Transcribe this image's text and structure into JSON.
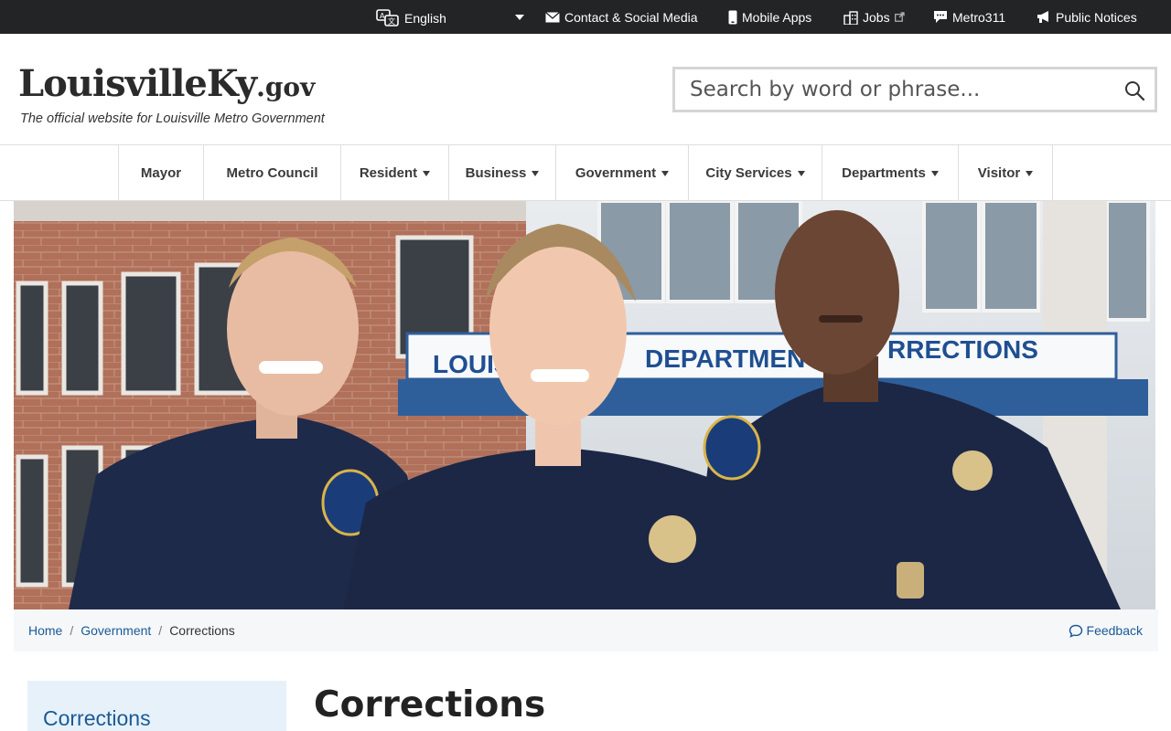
{
  "topbar": {
    "language": "English",
    "links": [
      {
        "label": "Contact & Social Media",
        "icon": "envelope-icon"
      },
      {
        "label": "Mobile Apps",
        "icon": "phone-icon"
      },
      {
        "label": "Jobs",
        "icon": "buildings-icon",
        "external_icon": "external-link-icon"
      },
      {
        "label": "Metro311",
        "icon": "chat-icon"
      },
      {
        "label": "Public Notices",
        "icon": "megaphone-icon"
      }
    ]
  },
  "header": {
    "logo_main": "LouisvilleKy",
    "logo_tld": ".gov",
    "tagline": "The official website for Louisville Metro Government"
  },
  "search": {
    "placeholder": "Search by word or phrase..."
  },
  "nav": {
    "items": [
      {
        "label": "Mayor",
        "dropdown": false
      },
      {
        "label": "Metro Council",
        "dropdown": false
      },
      {
        "label": "Resident",
        "dropdown": true
      },
      {
        "label": "Business",
        "dropdown": true
      },
      {
        "label": "Government",
        "dropdown": true
      },
      {
        "label": "City Services",
        "dropdown": true
      },
      {
        "label": "Departments",
        "dropdown": true
      },
      {
        "label": "Visitor",
        "dropdown": true
      }
    ]
  },
  "hero": {
    "sign_left": "LOUISV",
    "sign_mid": "DEPARTMEN",
    "sign_right": "RRECTIONS"
  },
  "breadcrumb": {
    "items": [
      "Home",
      "Government",
      "Corrections"
    ]
  },
  "feedback": {
    "label": "Feedback"
  },
  "sidebar": {
    "title": "Corrections"
  },
  "main": {
    "title": "Corrections"
  },
  "colors": {
    "topbar_bg": "#222426",
    "link": "#1a5a96",
    "sidebar_bg": "#e7f1fa",
    "uniform": "#1e2a4a"
  }
}
